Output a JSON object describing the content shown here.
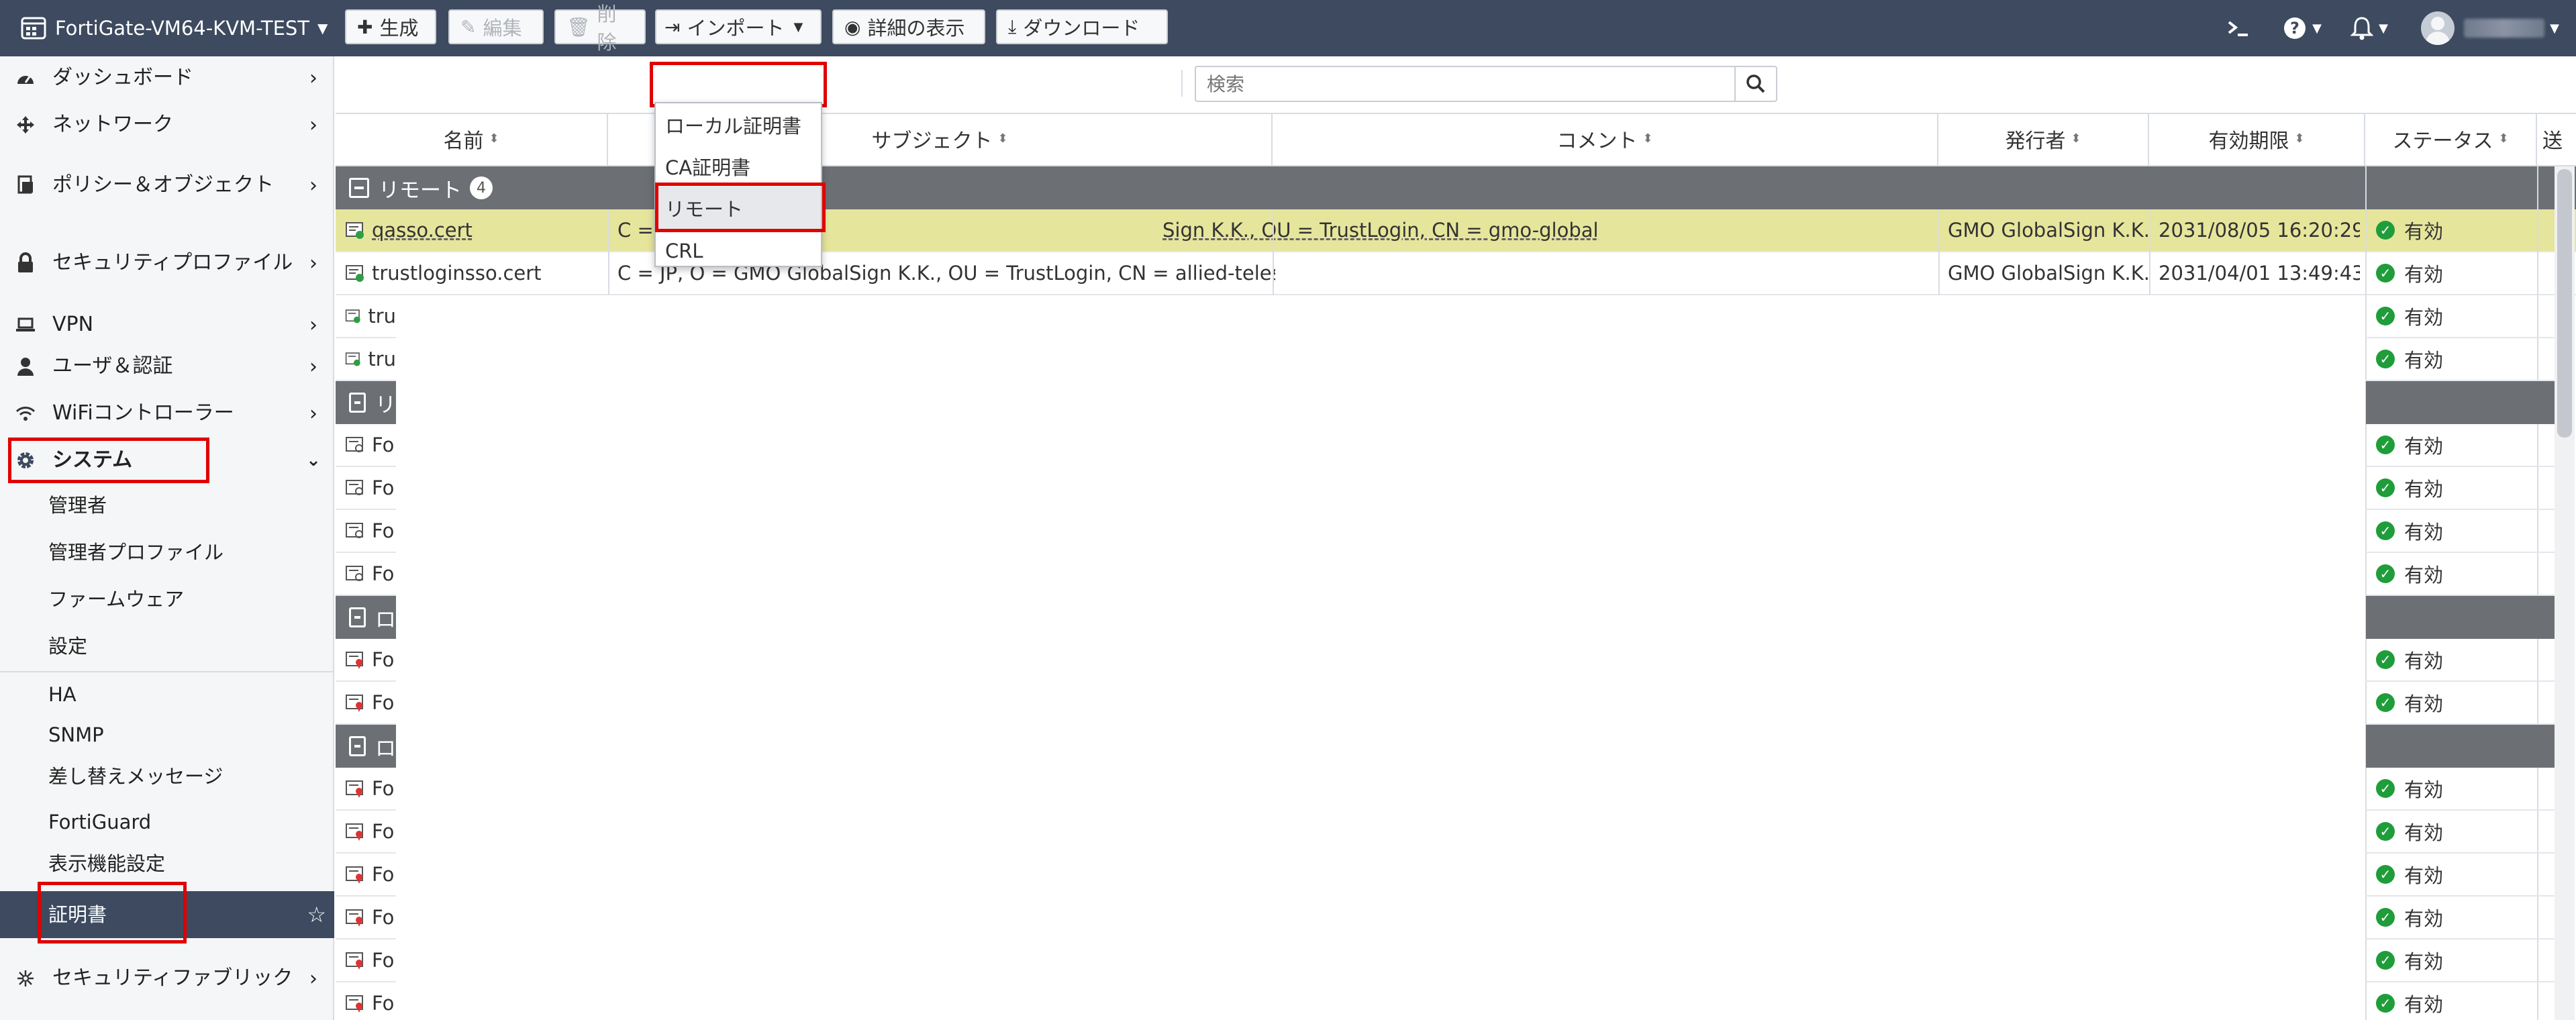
{
  "topbar": {
    "device_name": "FortiGate-VM64-KVM-TEST",
    "icons": [
      "device-icon",
      "menu-icon",
      "search-icon",
      "cli-icon",
      "help-icon",
      "bell-icon",
      "user-avatar"
    ]
  },
  "sidebar": {
    "items": [
      {
        "label": "ダッシュボード",
        "icon": "dashboard-icon"
      },
      {
        "label": "ネットワーク",
        "icon": "network-icon"
      },
      {
        "label": "ポリシー＆オブジェクト",
        "icon": "policy-icon"
      },
      {
        "label": "セキュリティプロファイル",
        "icon": "lock-icon"
      },
      {
        "label": "VPN",
        "icon": "laptop-icon"
      },
      {
        "label": "ユーザ＆認証",
        "icon": "user-icon"
      },
      {
        "label": "WiFiコントローラー",
        "icon": "wifi-icon"
      },
      {
        "label": "システム",
        "icon": "gear-icon"
      }
    ],
    "system_children": [
      "管理者",
      "管理者プロファイル",
      "ファームウェア",
      "設定",
      "HA",
      "SNMP",
      "差し替えメッセージ",
      "FortiGuard",
      "表示機能設定",
      "証明書"
    ],
    "active_child": "証明書",
    "last_item": {
      "label": "セキュリティファブリック",
      "icon": "fabric-icon"
    }
  },
  "toolbar": {
    "create": "生成",
    "edit": "編集",
    "delete": "削除",
    "import": "インポート",
    "details": "詳細の表示",
    "download": "ダウンロード",
    "search_placeholder": "検索"
  },
  "import_menu": {
    "items": [
      "ローカル証明書",
      "CA証明書",
      "リモート",
      "CRL"
    ],
    "highlighted": "リモート"
  },
  "table": {
    "columns": [
      "名前",
      "サブジェクト",
      "コメント",
      "発行者",
      "有効期限",
      "ステータス",
      "送"
    ],
    "group_label": "リモート",
    "group_count": "4",
    "rows": [
      {
        "name": "qasso.cert",
        "subject_visible": "C =",
        "subject_tail": "Sign K.K., OU = TrustLogin, CN = gmo-globalsign...",
        "issuer": "GMO GlobalSign K.K.",
        "expiry": "2031/08/05 16:20:29",
        "status": "有効",
        "selected": true
      },
      {
        "name": "trustloginsso.cert",
        "subject_visible": "C = JP, O = GMO GlobalSign K.K., OU = TrustLogin, CN = allied-telesis",
        "subject_tail": "",
        "issuer": "GMO GlobalSign K.K.",
        "expiry": "2031/04/01 13:49:43",
        "status": "有効",
        "selected": false
      }
    ],
    "truncated_names": [
      "tru",
      "tru",
      "リ",
      "Fo",
      "Fo",
      "Fo",
      "Fo",
      "ロ",
      "Fo",
      "Fo",
      "ロ",
      "Fo",
      "Fo",
      "Fo",
      "Fo",
      "Fo",
      "Fo"
    ],
    "status_ok": "有効"
  }
}
